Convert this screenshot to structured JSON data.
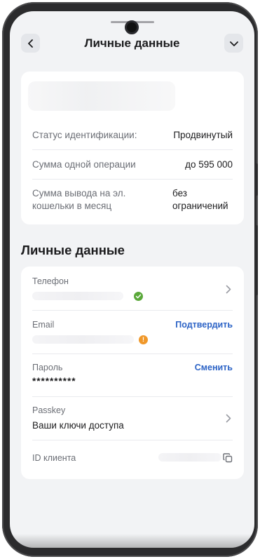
{
  "header": {
    "title": "Личные данные"
  },
  "limits": {
    "rows": [
      {
        "label": "Статус идентификации:",
        "value": "Продвинутый"
      },
      {
        "label": "Сумма одной операции",
        "value": "до 595 000"
      },
      {
        "label_line1": "Сумма вывода на эл.",
        "label_line2": "кошельки в месяц",
        "value_line1": "без",
        "value_line2": "ограничений"
      }
    ]
  },
  "personal": {
    "section_title": "Личные данные",
    "phone": {
      "label": "Телефон"
    },
    "email": {
      "label": "Email",
      "action": "Подтвердить",
      "status_icon": "!"
    },
    "password": {
      "label": "Пароль",
      "value": "**********",
      "action": "Сменить"
    },
    "passkey": {
      "label": "Passkey",
      "value": "Ваши ключи доступа"
    },
    "client_id": {
      "label": "ID клиента"
    }
  },
  "colors": {
    "link": "#2c63c6",
    "verified": "#5aa83a",
    "warning": "#f0982a",
    "background": "#f2f3f5"
  },
  "icons": [
    "back-chevron-icon",
    "chevron-down-icon",
    "check-icon",
    "warning-icon",
    "chevron-right-icon",
    "copy-icon"
  ]
}
